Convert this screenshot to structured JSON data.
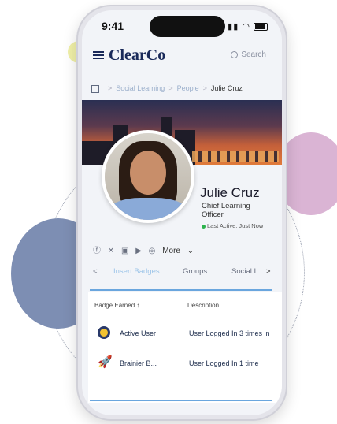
{
  "status_bar": {
    "time": "9:41"
  },
  "app": {
    "logo": "ClearCo",
    "search_label": "Search"
  },
  "breadcrumb": {
    "items": [
      "Social Learning",
      "People",
      "Julie Cruz"
    ],
    "separator": ">"
  },
  "profile": {
    "name": "Julie Cruz",
    "title": "Chief Learning Officer",
    "last_active": "Last Active: Just Now",
    "more_label": "More"
  },
  "social_icons": [
    "facebook-icon",
    "x-icon",
    "linkedin-icon",
    "youtube-icon",
    "instagram-icon"
  ],
  "tabs": {
    "prev": "<",
    "next": ">",
    "items": [
      "Insert Badges",
      "Groups",
      "Social I"
    ]
  },
  "badge_table": {
    "headers": [
      "Badge Earned",
      "Description"
    ],
    "rows": [
      {
        "name": "Active User",
        "description": "User Logged In 3 times in",
        "icon": "clock-badge-icon",
        "color": "#2a3a6a"
      },
      {
        "name": "Brainier B...",
        "description": "User Logged In 1 time",
        "icon": "rocket-badge-icon",
        "color": "#4a6ad8"
      }
    ]
  },
  "colors": {
    "brand": "#1a2a5a",
    "accent": "#6aa6de",
    "active_dot": "#2bb24c"
  }
}
